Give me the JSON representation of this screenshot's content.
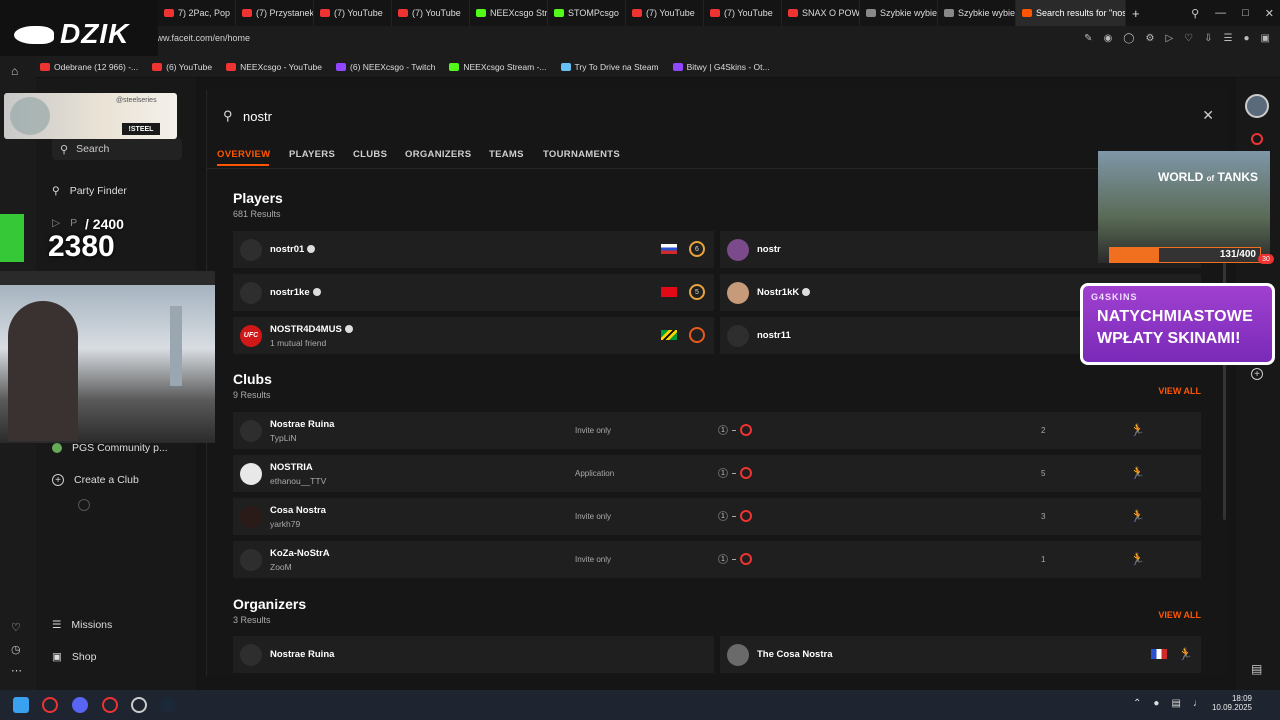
{
  "browser": {
    "tabs": [
      {
        "label": "7) 2Pac, Pop",
        "color": "#e33"
      },
      {
        "label": "(7) Przystanek Lo",
        "color": "#e33"
      },
      {
        "label": "(7) YouTube",
        "color": "#e33"
      },
      {
        "label": "(7) YouTube",
        "color": "#e33"
      },
      {
        "label": "NEEXcsgo Stream",
        "color": "#53fc18"
      },
      {
        "label": "STOMPcsgo",
        "color": "#53fc18"
      },
      {
        "label": "(7) YouTube",
        "color": "#e33"
      },
      {
        "label": "(7) YouTube",
        "color": "#e33"
      },
      {
        "label": "SNAX O POWRO",
        "color": "#e33"
      },
      {
        "label": "Szybkie wybieran",
        "color": "#888"
      },
      {
        "label": "Szybkie wybiera",
        "color": "#888"
      },
      {
        "label": "Search results for \"nostr\"",
        "color": "#ff5500"
      }
    ],
    "url": "www.faceit.com/en/home",
    "bookmarks": [
      {
        "label": "Odebrane (12 966) -...",
        "color": "#e33"
      },
      {
        "label": "(6) YouTube",
        "color": "#e33"
      },
      {
        "label": "NEEXcsgo - YouTube",
        "color": "#e33"
      },
      {
        "label": "(6) NEEXcsgo - Twitch",
        "color": "#9146ff"
      },
      {
        "label": "NEEXcsgo Stream -...",
        "color": "#53fc18"
      },
      {
        "label": "Try To Drive na Steam",
        "color": "#66c0f4"
      },
      {
        "label": "Bitwy | G4Skins - Ot...",
        "color": "#9146ff"
      }
    ]
  },
  "overlay": {
    "dzik_logo": "DZIK",
    "sponsor_small": "@steelseries",
    "sponsor_code": "!STEEL",
    "counter_goal": "/ 2400",
    "counter_value": "2380",
    "wot_progress_text": "131/400",
    "wot_progress_fraction": 0.3275,
    "g4_brand": "G4SKINS",
    "g4_line1": "NATYCHMIASTOWE",
    "g4_line2": "WPŁATY SKINAMI!",
    "badge_count": "30"
  },
  "sidebar": {
    "search_placeholder": "Search",
    "party_finder": "Party Finder",
    "play_label": "P",
    "community": "PGS Community p...",
    "create_club": "Create a Club",
    "missions": "Missions",
    "shop": "Shop"
  },
  "search": {
    "query": "nostr",
    "tabs": [
      "OVERVIEW",
      "PLAYERS",
      "CLUBS",
      "ORGANIZERS",
      "TEAMS",
      "TOURNAMENTS"
    ],
    "players_title": "Players",
    "players_count": "681 Results",
    "players": [
      {
        "name": "nostr01",
        "sub": "",
        "level": "6"
      },
      {
        "name": "nostr",
        "sub": "",
        "level": ""
      },
      {
        "name": "nostr1ke",
        "sub": "",
        "level": "5"
      },
      {
        "name": "Nostr1kK",
        "sub": "",
        "level": ""
      },
      {
        "name": "NOSTR4D4MUS",
        "sub": "1 mutual friend",
        "level": ""
      },
      {
        "name": "nostr11",
        "sub": "",
        "level": ""
      }
    ],
    "clubs_title": "Clubs",
    "clubs_count": "9 Results",
    "view_all": "VIEW ALL",
    "clubs": [
      {
        "name": "Nostrae Ruina",
        "owner": "TypLiN",
        "join": "Invite only",
        "range_min": "1",
        "members": "2"
      },
      {
        "name": "NOSTRIA",
        "owner": "ethanou__TTV",
        "join": "Application",
        "range_min": "1",
        "members": "5"
      },
      {
        "name": "Cosa Nostra",
        "owner": "yarkh79",
        "join": "Invite only",
        "range_min": "1",
        "members": "3"
      },
      {
        "name": "KoZa-NoStrA",
        "owner": "ZooM",
        "join": "Invite only",
        "range_min": "1",
        "members": "1"
      }
    ],
    "org_title": "Organizers",
    "org_count": "3 Results",
    "organizers": [
      {
        "name": "Nostrae Ruina"
      },
      {
        "name": "The Cosa Nostra"
      }
    ],
    "ufc_text": "UFC"
  },
  "taskbar": {
    "time": "18:09",
    "date": "10.09.2025"
  }
}
